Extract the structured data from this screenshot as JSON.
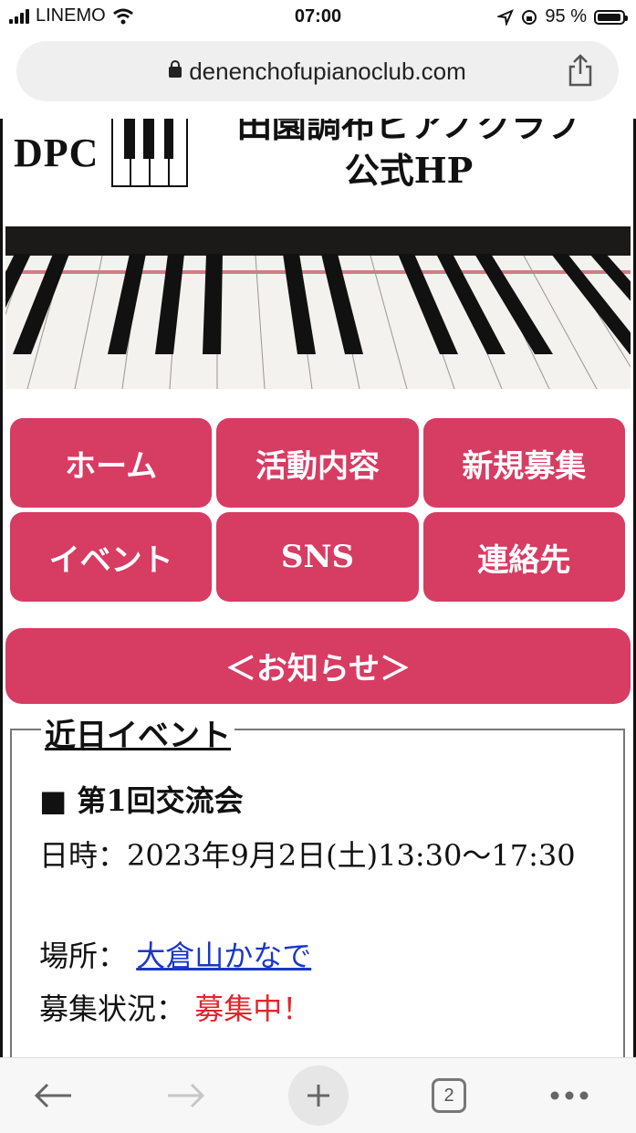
{
  "status_bar": {
    "carrier": "LINEMO",
    "time": "07:00",
    "battery": "95 %",
    "battery_level": 0.95
  },
  "address_bar": {
    "url": "denenchofupianoclub.com"
  },
  "header": {
    "logo_text": "DPC",
    "title_line1": "田園調布ピアノクラブ",
    "title_line2": "公式HP"
  },
  "nav": {
    "items": [
      {
        "label": "ホーム"
      },
      {
        "label": "活動内容"
      },
      {
        "label": "新規募集"
      },
      {
        "label": "イベント"
      },
      {
        "label": "SNS"
      },
      {
        "label": "連絡先"
      }
    ],
    "notice_label": "＜お知らせ＞"
  },
  "events": {
    "legend": "近日イベント",
    "title": "■ 第1回交流会",
    "date_label": "日時：",
    "date_value": "2023年9月2日(土)13:30〜17:30",
    "place_label": "場所：",
    "place_value": "大倉山かなで",
    "status_label": "募集状況：",
    "status_value": "募集中！"
  },
  "toolbar": {
    "tab_count": "2"
  },
  "colors": {
    "accent": "#d73c63",
    "link": "#1a36c8",
    "status_red": "#e3242b"
  },
  "icons": [
    "signal-icon",
    "wifi-icon",
    "location-icon",
    "rotation-lock-icon",
    "battery-icon",
    "lock-icon",
    "share-icon",
    "back-arrow-icon",
    "forward-arrow-icon",
    "plus-icon",
    "tabs-icon",
    "more-icon"
  ]
}
